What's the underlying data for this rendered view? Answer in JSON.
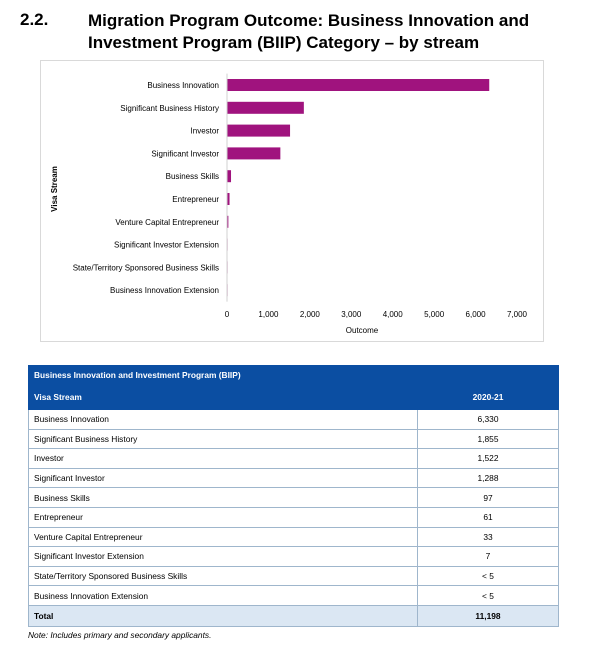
{
  "heading": {
    "number": "2.2.",
    "title": "Migration Program Outcome: Business Innovation and Investment Program (BIIP) Category – by stream"
  },
  "chart_data": {
    "type": "bar",
    "orientation": "horizontal",
    "categories": [
      "Business Innovation",
      "Significant Business History",
      "Investor",
      "Significant Investor",
      "Business Skills",
      "Entrepreneur",
      "Venture Capital Entrepreneur",
      "Significant Investor Extension",
      "State/Territory Sponsored Business Skills",
      "Business Innovation Extension"
    ],
    "values": [
      6330,
      1855,
      1522,
      1288,
      97,
      61,
      33,
      7,
      2,
      2
    ],
    "xlabel": "Outcome",
    "ylabel": "Visa Stream",
    "xlim": [
      0,
      7000
    ],
    "xticks": [
      0,
      1000,
      2000,
      3000,
      4000,
      5000,
      6000,
      7000
    ],
    "xtick_labels": [
      "0",
      "1,000",
      "2,000",
      "3,000",
      "4,000",
      "5,000",
      "6,000",
      "7,000"
    ],
    "bar_color": "#a0137e",
    "grid": false
  },
  "table": {
    "caption": "Business Innovation and Investment Program (BIIP)",
    "col_stream": "Visa Stream",
    "col_year": "2020-21",
    "rows": [
      {
        "stream": "Business Innovation",
        "value": "6,330"
      },
      {
        "stream": "Significant Business History",
        "value": "1,855"
      },
      {
        "stream": "Investor",
        "value": "1,522"
      },
      {
        "stream": "Significant Investor",
        "value": "1,288"
      },
      {
        "stream": "Business Skills",
        "value": "97"
      },
      {
        "stream": "Entrepreneur",
        "value": "61"
      },
      {
        "stream": "Venture Capital Entrepreneur",
        "value": "33"
      },
      {
        "stream": "Significant Investor Extension",
        "value": "7"
      },
      {
        "stream": "State/Territory Sponsored Business Skills",
        "value": "< 5"
      },
      {
        "stream": "Business Innovation Extension",
        "value": "< 5"
      }
    ],
    "total_label": "Total",
    "total_value": "11,198",
    "header_color": "#0b4ea2",
    "total_row_color": "#dbe7f3"
  },
  "note": "Note: Includes primary and secondary applicants."
}
